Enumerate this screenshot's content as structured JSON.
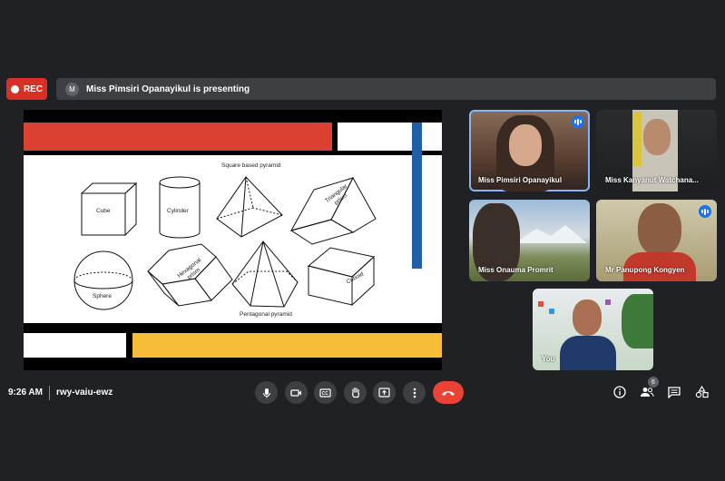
{
  "recording": {
    "label": "REC"
  },
  "banner": {
    "avatar_letter": "M",
    "text": "Miss Pimsiri Opanayikul is presenting"
  },
  "slide": {
    "labels": {
      "cube": "Cube",
      "cylinder": "Cylinder",
      "square_pyramid": "Square based pyramid",
      "triangular_prism_1": "Triangular",
      "triangular_prism_2": "prism",
      "sphere": "Sphere",
      "hexagonal_prism_1": "Hexagonal",
      "hexagonal_prism_2": "prism",
      "pentagonal_pyramid": "Pentagonal pyramid",
      "cuboid": "Cuboid"
    },
    "colors": {
      "red": "#db4130",
      "blue": "#1f5ea8",
      "yellow": "#f5bd38"
    }
  },
  "participants": [
    {
      "name": "Miss Pimsiri Opanayikul",
      "speaking": true
    },
    {
      "name": "Miss Kanyanut Watchana...",
      "speaking": false
    },
    {
      "name": "Miss Onauma Promrit",
      "speaking": false
    },
    {
      "name": "Mr Panupong Kongyen",
      "speaking": true
    },
    {
      "name": "You",
      "speaking": false
    }
  ],
  "footer": {
    "time": "9:26 AM",
    "meeting_code": "rwy-vaiu-ewz",
    "people_count": "6"
  },
  "icons": [
    "mic-icon",
    "camera-icon",
    "captions-icon",
    "raise-hand-icon",
    "present-icon",
    "more-options-icon",
    "end-call-icon",
    "info-icon",
    "people-icon",
    "chat-icon",
    "activities-icon"
  ]
}
